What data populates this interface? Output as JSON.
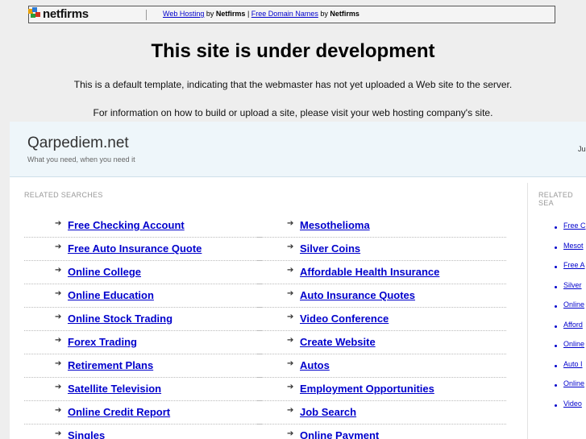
{
  "banner": {
    "logo_text": "netfirms",
    "link1": "Web Hosting",
    "by1": "by",
    "brand1": "Netfirms",
    "pipe": "|",
    "link2": "Free Domain Names",
    "by2": "by",
    "brand2": "Netfirms"
  },
  "dev": {
    "title": "This site is under development",
    "line1": "This is a default template, indicating that the webmaster has not yet uploaded a Web site to the server.",
    "line2": "For information on how to build or upload a site, please visit your web hosting company's site."
  },
  "site": {
    "name": "Qarpediem.net",
    "tagline": "What you need, when you need it",
    "right_text": "Ju"
  },
  "related": {
    "label_left": "RELATED SEARCHES",
    "label_right": "RELATED SEA",
    "left_col": [
      "Free Checking Account",
      "Free Auto Insurance Quote",
      "Online College",
      "Online Education",
      "Online Stock Trading",
      "Forex Trading",
      "Retirement Plans",
      "Satellite Television",
      "Online Credit Report",
      "Singles"
    ],
    "mid_col": [
      "Mesothelioma",
      "Silver Coins",
      "Affordable Health Insurance",
      "Auto Insurance Quotes",
      "Video Conference",
      "Create Website",
      "Autos",
      "Employment Opportunities",
      "Job Search",
      "Online Payment"
    ],
    "right_col": [
      "Free C",
      "Mesot",
      "Free A",
      "Silver",
      "Online",
      "Afford",
      "Online",
      "Auto I",
      "Online",
      "Video"
    ]
  },
  "colors": {
    "link": "#0000cc",
    "header_bg": "#eef6fa",
    "page_bg": "#eeeeee"
  }
}
